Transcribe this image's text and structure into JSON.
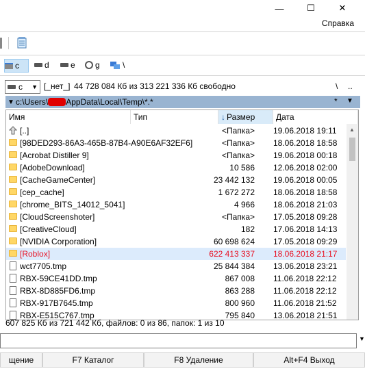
{
  "window": {
    "min_glyph": "—",
    "max_glyph": "☐",
    "close_glyph": "✕"
  },
  "menu": {
    "help": "Справка"
  },
  "drives": [
    {
      "label": "c",
      "selected": true
    },
    {
      "label": "d",
      "selected": false
    },
    {
      "label": "e",
      "selected": false
    },
    {
      "label": "g",
      "selected": false
    },
    {
      "label": "\\",
      "selected": false
    }
  ],
  "infobar": {
    "drive_value": "c",
    "label": "[_нет_]",
    "free_text": "44 728 084 Кб из 313 221 336 Кб свободно",
    "root_btn": "\\",
    "up_btn": ".."
  },
  "path": {
    "prefix": "c:\\Users\\",
    "suffix": "AppData\\Local\\Temp\\*.*",
    "star": "*",
    "arrow": "▼"
  },
  "columns": {
    "name": "Имя",
    "type": "Тип",
    "size": "Размер",
    "date": "Дата",
    "sort_arrow": "🡓"
  },
  "files": [
    {
      "icon": "up",
      "name": "[..]",
      "size": "<Папка>",
      "date": "19.06.2018 19:11"
    },
    {
      "icon": "folder",
      "name": "[98DED293-86A3-465B-87B4-A90E6AF32EF6]",
      "size": "<Папка>",
      "date": "18.06.2018 18:58"
    },
    {
      "icon": "folder",
      "name": "[Acrobat Distiller 9]",
      "size": "<Папка>",
      "date": "19.06.2018 00:18"
    },
    {
      "icon": "folder",
      "name": "[AdobeDownload]",
      "size": "10 586",
      "date": "12.06.2018 02:00"
    },
    {
      "icon": "folder",
      "name": "[CacheGameCenter]",
      "size": "23 442 132",
      "date": "19.06.2018 00:05"
    },
    {
      "icon": "folder",
      "name": "[cep_cache]",
      "size": "1 672 272",
      "date": "18.06.2018 18:58"
    },
    {
      "icon": "folder",
      "name": "[chrome_BITS_14012_5041]",
      "size": "4 966",
      "date": "18.06.2018 21:03"
    },
    {
      "icon": "folder",
      "name": "[CloudScreenshoter]",
      "size": "<Папка>",
      "date": "17.05.2018 09:28"
    },
    {
      "icon": "folder",
      "name": "[CreativeCloud]",
      "size": "182",
      "date": "17.06.2018 14:13"
    },
    {
      "icon": "folder",
      "name": "[NVIDIA Corporation]",
      "size": "60 698 624",
      "date": "17.05.2018 09:29"
    },
    {
      "icon": "folder",
      "name": "[Roblox]",
      "size": "622 413 337",
      "date": "18.06.2018 21:17",
      "selected": true
    },
    {
      "icon": "file",
      "name": "wct7705.tmp",
      "size": "25 844 384",
      "date": "13.06.2018 23:21"
    },
    {
      "icon": "file",
      "name": "RBX-59CE41DD.tmp",
      "size": "867 008",
      "date": "11.06.2018 22:12"
    },
    {
      "icon": "file",
      "name": "RBX-8D885FD6.tmp",
      "size": "863 288",
      "date": "11.06.2018 22:12"
    },
    {
      "icon": "file",
      "name": "RBX-917B7645.tmp",
      "size": "800 960",
      "date": "11.06.2018 21:52"
    },
    {
      "icon": "file",
      "name": "RBX-E515C767.tmp",
      "size": "795 840",
      "date": "13.06.2018 21:51"
    }
  ],
  "status": "607 825 Кб из 721 442 Кб, файлов: 0 из 86, папок: 1 из 10",
  "fkeys": [
    {
      "label": "щение"
    },
    {
      "label": "F7 Каталог"
    },
    {
      "label": "F8 Удаление"
    },
    {
      "label": "Alt+F4 Выход"
    }
  ],
  "colors": {
    "selection_text": "#e81123",
    "path_bg": "#99b4d1",
    "redaction": "#e00000"
  }
}
